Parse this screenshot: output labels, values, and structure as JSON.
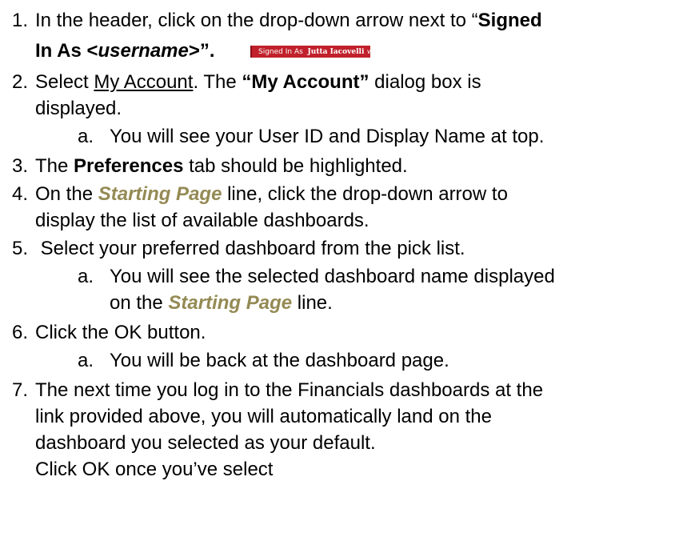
{
  "steps": [
    {
      "num": "1.",
      "line1_text": "In the header, click on the drop-down arrow next to “",
      "line1_bold": "Signed",
      "line2_bold": "In As <",
      "line2_bold_italic": "username",
      "line2_bold_end": ">”.",
      "badge": {
        "signed_in_as": "Signed In As",
        "username": "Jutta Iacovelli",
        "caret": "∨"
      }
    },
    {
      "num": "2.",
      "line1_a": "Select ",
      "line1_link": "My Account",
      "line1_b": ".  The ",
      "line1_bold": "“My Account”",
      "line1_c": " dialog box is",
      "line2": "displayed.",
      "sub": [
        {
          "letter": "a.",
          "text": "You will see your User ID and Display Name at top."
        }
      ]
    },
    {
      "num": "3.",
      "a": "The ",
      "bold": "Preferences",
      "b": " tab should be highlighted."
    },
    {
      "num": "4.",
      "a": "On the ",
      "gold": "Starting Page",
      "b": " line, click the drop-down arrow to",
      "line2": "display the list of available dashboards."
    },
    {
      "num": "5.",
      "text": " Select your preferred dashboard from the pick list.",
      "sub": [
        {
          "letter": "a.",
          "line1": "You will see the selected dashboard name displayed",
          "line2_a": "on the ",
          "line2_gold": "Starting Page",
          "line2_b": " line."
        }
      ]
    },
    {
      "num": "6.",
      "text": "Click the OK button.",
      "sub": [
        {
          "letter": "a.",
          "text": "You will be back at the dashboard page."
        }
      ]
    },
    {
      "num": "7.",
      "line1": "The next time you log in to the Financials dashboards at the",
      "line2": "link provided above, you will automatically land on the",
      "line3": "dashboard you selected as your default.",
      "line4": "Click OK once you’ve select"
    }
  ],
  "colors": {
    "text": "#000000",
    "starting_page_gold": "#948a54",
    "badge_red": "#c0212b"
  }
}
